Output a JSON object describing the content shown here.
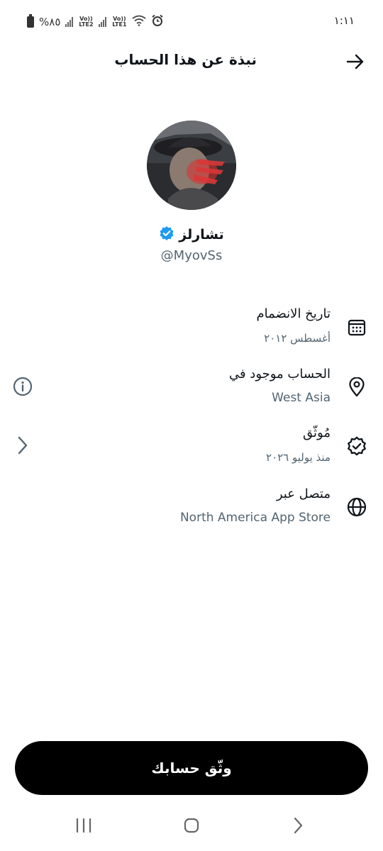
{
  "status_bar": {
    "time": "١:١١",
    "battery_text": "%٨٥",
    "sim1_label": "Vo)) LTE2",
    "sim2_label": "Vo)) LTE1",
    "icons": [
      "battery-icon",
      "signal-icon",
      "wifi-icon",
      "alarm-icon"
    ]
  },
  "header": {
    "title": "نبذة عن هذا الحساب",
    "back_icon": "arrow-right-icon"
  },
  "profile": {
    "display_name": "تشارلز",
    "handle": "@MyovSs",
    "verified_badge_color": "#1d9bf0"
  },
  "info": {
    "joined": {
      "title": "تاريخ الانضمام",
      "value": "أغسطس ٢٠١٢",
      "icon": "calendar-icon"
    },
    "location": {
      "title": "الحساب موجود في",
      "value": "West Asia",
      "icon": "location-pin-icon",
      "side_icon": "info-icon"
    },
    "verified": {
      "title": "مُوثّق",
      "value": "منذ يوليو ٢٠٢٦",
      "icon": "verified-badge-icon",
      "side_icon": "chevron-left-icon"
    },
    "connected": {
      "title": "متصل عبر",
      "value": "North America App Store",
      "icon": "globe-icon"
    }
  },
  "cta": {
    "label": "وثّق حسابك"
  },
  "nav": {
    "icons": [
      "recents-icon",
      "home-icon",
      "back-icon"
    ]
  },
  "colors": {
    "text_primary": "#0f1419",
    "text_secondary": "#536471",
    "button_bg": "#000000",
    "accent": "#1d9bf0"
  }
}
